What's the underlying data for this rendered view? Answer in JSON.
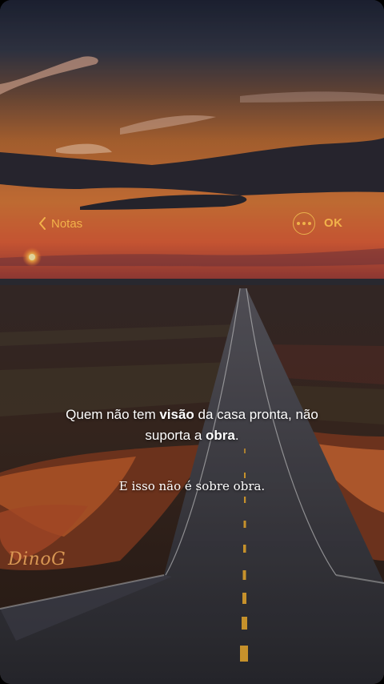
{
  "nav": {
    "back_label": "Notas",
    "done_label": "OK"
  },
  "note": {
    "line1_a": "Quem não tem ",
    "line1_b": "visão",
    "line1_c": " da casa pronta, não",
    "line2_a": "suporta a ",
    "line2_b": "obra",
    "line2_c": ".",
    "subline": "E isso não é sobre obra."
  },
  "watermark": "DinoG",
  "colors": {
    "accent": "#f2b24a",
    "text": "#ffffff"
  },
  "icons": {
    "back": "chevron-left-icon",
    "more": "ellipsis-circle-icon"
  }
}
